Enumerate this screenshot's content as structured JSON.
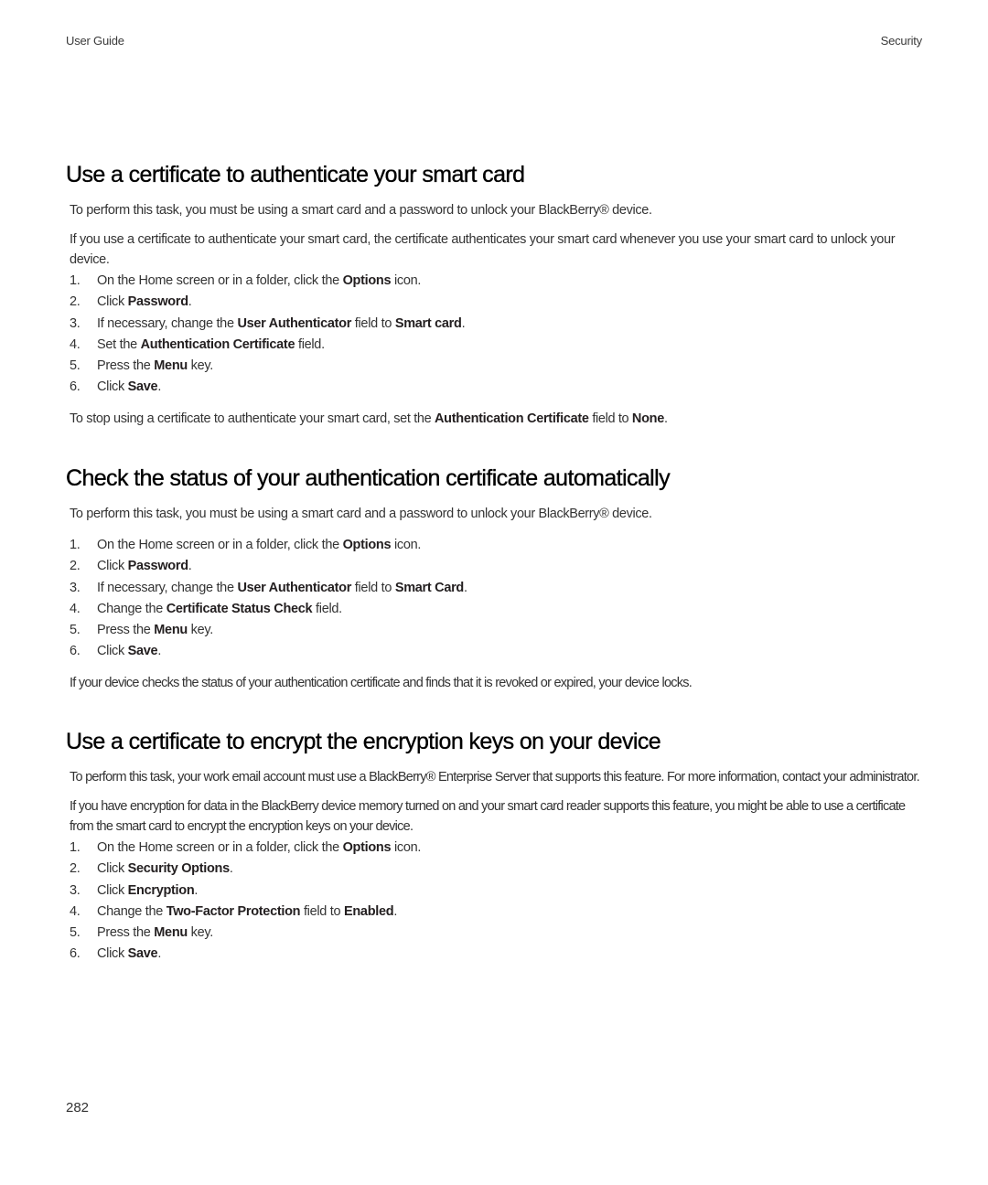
{
  "header": {
    "left": "User Guide",
    "right": "Security"
  },
  "sections": [
    {
      "title": "Use a certificate to authenticate your smart card",
      "intro": "To perform this task, you must be using a smart card and a password to unlock your BlackBerry® device.",
      "intro2": "If you use a certificate to authenticate your smart card, the certificate authenticates your smart card whenever you use your smart card to unlock your device.",
      "steps": [
        {
          "num": "1.",
          "parts": [
            "On the Home screen or in a folder, click the ",
            "Options",
            " icon."
          ]
        },
        {
          "num": "2.",
          "parts": [
            "Click ",
            "Password",
            "."
          ]
        },
        {
          "num": "3.",
          "parts": [
            "If necessary, change the ",
            "User Authenticator",
            " field to ",
            "Smart card",
            "."
          ]
        },
        {
          "num": "4.",
          "parts": [
            "Set the ",
            "Authentication Certificate",
            " field."
          ]
        },
        {
          "num": "5.",
          "parts": [
            "Press the ",
            "Menu",
            " key."
          ]
        },
        {
          "num": "6.",
          "parts": [
            "Click ",
            "Save",
            "."
          ]
        }
      ],
      "note_parts": [
        "To stop using a certificate to authenticate your smart card, set the ",
        "Authentication Certificate",
        " field to ",
        "None",
        "."
      ]
    },
    {
      "title": "Check the status of your authentication certificate automatically",
      "intro": "To perform this task, you must be using a smart card and a password to unlock your BlackBerry® device.",
      "steps": [
        {
          "num": "1.",
          "parts": [
            "On the Home screen or in a folder, click the ",
            "Options",
            " icon."
          ]
        },
        {
          "num": "2.",
          "parts": [
            "Click ",
            "Password",
            "."
          ]
        },
        {
          "num": "3.",
          "parts": [
            "If necessary, change the ",
            "User Authenticator",
            " field to ",
            "Smart Card",
            "."
          ]
        },
        {
          "num": "4.",
          "parts": [
            "Change the ",
            "Certificate Status Check",
            " field."
          ]
        },
        {
          "num": "5.",
          "parts": [
            "Press the ",
            "Menu",
            " key."
          ]
        },
        {
          "num": "6.",
          "parts": [
            "Click ",
            "Save",
            "."
          ]
        }
      ],
      "note": "If your device checks the status of your authentication certificate and finds that it is revoked or expired, your device locks."
    },
    {
      "title": "Use a certificate to encrypt the encryption keys on your device",
      "intro": "To perform this task, your work email account must use a BlackBerry® Enterprise Server that supports this feature. For more information, contact your administrator.",
      "intro2": "If you have encryption for data in the BlackBerry device memory turned on and your smart card reader supports this feature, you might be able to use a certificate from the smart card to encrypt the encryption keys on your device.",
      "steps": [
        {
          "num": "1.",
          "parts": [
            "On the Home screen or in a folder, click the ",
            "Options",
            " icon."
          ]
        },
        {
          "num": "2.",
          "parts": [
            "Click ",
            "Security Options",
            "."
          ]
        },
        {
          "num": "3.",
          "parts": [
            "Click ",
            "Encryption",
            "."
          ]
        },
        {
          "num": "4.",
          "parts": [
            "Change the ",
            "Two-Factor Protection",
            " field to ",
            "Enabled",
            "."
          ]
        },
        {
          "num": "5.",
          "parts": [
            "Press the ",
            "Menu",
            " key."
          ]
        },
        {
          "num": "6.",
          "parts": [
            "Click ",
            "Save",
            "."
          ]
        }
      ]
    }
  ],
  "footer": {
    "page_number": "282"
  }
}
